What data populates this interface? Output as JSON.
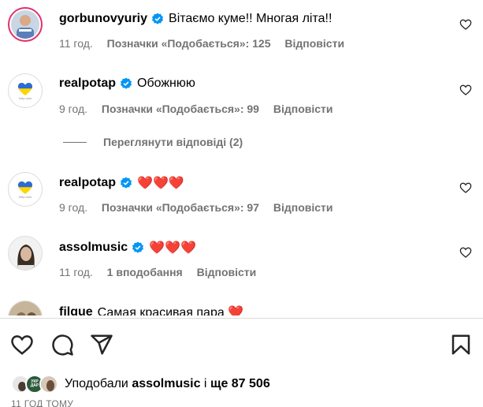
{
  "comments": [
    {
      "username": "gorbunovyuriy",
      "text": "Вітаємо куме!! Многая літа!!",
      "time": "11 год.",
      "likes": "Позначки «Подобається»: 125",
      "reply": "Відповісти"
    },
    {
      "username": "realpotap",
      "text": "Обожнюю",
      "time": "9 год.",
      "likes": "Позначки «Подобається»: 99",
      "reply": "Відповісти",
      "avatar_text": "help.now"
    },
    {
      "username": "realpotap",
      "text": "❤️❤️❤️",
      "time": "9 год.",
      "likes": "Позначки «Подобається»: 97",
      "reply": "Відповісти",
      "avatar_text": "help.now"
    },
    {
      "username": "assolmusic",
      "text": "❤️❤️❤️",
      "time": "11 год.",
      "likes": "1 вподобання",
      "reply": "Відповісти"
    },
    {
      "username": "filgue",
      "text": "Самая красивая пара ❤️"
    }
  ],
  "view_replies": "Переглянути відповіді (2)",
  "likes_summary": {
    "prefix": "Уподобали",
    "user": "assolmusic",
    "mid": "і",
    "count": "ще 87 506"
  },
  "mini_avatar_text": "УКР ДАР",
  "time_ago": "11 ГОД ТОМУ",
  "icons": [
    "heart-icon",
    "comment-icon",
    "share-icon",
    "bookmark-icon",
    "verified-badge-icon"
  ],
  "colors": {
    "verified": "#0095f6",
    "muted": "#737373",
    "heart": "#ed4956"
  }
}
